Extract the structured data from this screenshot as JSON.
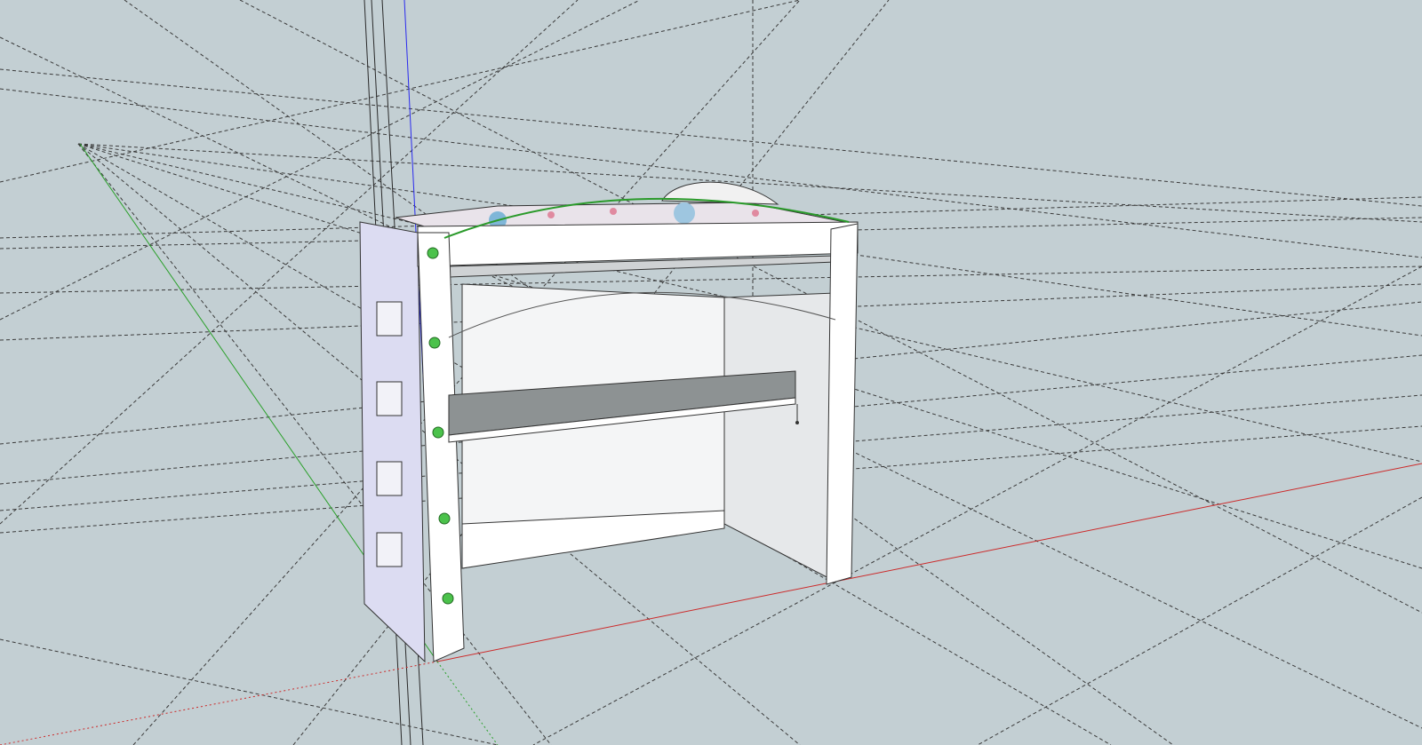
{
  "scene": {
    "background": "#c3cfd3",
    "axis_colors": {
      "red": "#cc2a2a",
      "green": "#2aa02a",
      "blue": "#2a2aee"
    },
    "guide_color": "#3a3a3a",
    "model_fill": "#ffffff",
    "side_fill": "#d9dbf0",
    "shade_fill": "#e3e6ea",
    "floor_fill": "#8a8f90",
    "inference_point_color": "#4bc24b",
    "arc_color": "#2a9a2a"
  }
}
